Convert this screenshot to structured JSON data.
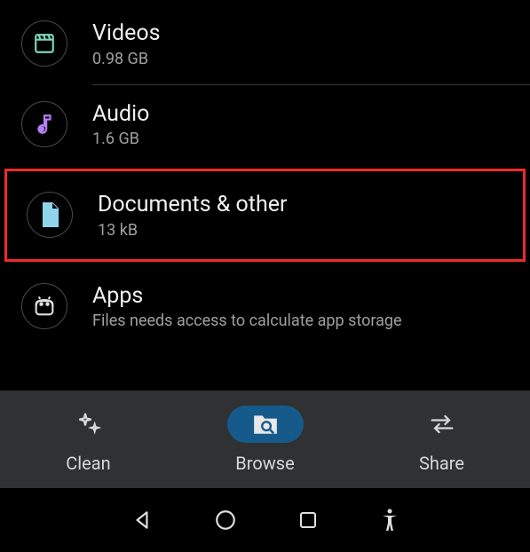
{
  "categories": [
    {
      "label": "Videos",
      "sub": "0.98 GB",
      "icon": "clapper",
      "color": "#7ed6b8"
    },
    {
      "label": "Audio",
      "sub": "1.6 GB",
      "icon": "music-note",
      "color": "#b67ff5"
    },
    {
      "label": "Documents & other",
      "sub": "13 kB",
      "icon": "document",
      "color": "#8fd4ec",
      "highlighted": true
    },
    {
      "label": "Apps",
      "sub": "Files needs access to calculate app storage",
      "icon": "android",
      "color": "#e0e0e0"
    }
  ],
  "tabs": {
    "clean": "Clean",
    "browse": "Browse",
    "share": "Share",
    "active": "browse"
  },
  "nav": {
    "back": "back",
    "home": "home",
    "recents": "recents",
    "accessibility": "accessibility"
  }
}
